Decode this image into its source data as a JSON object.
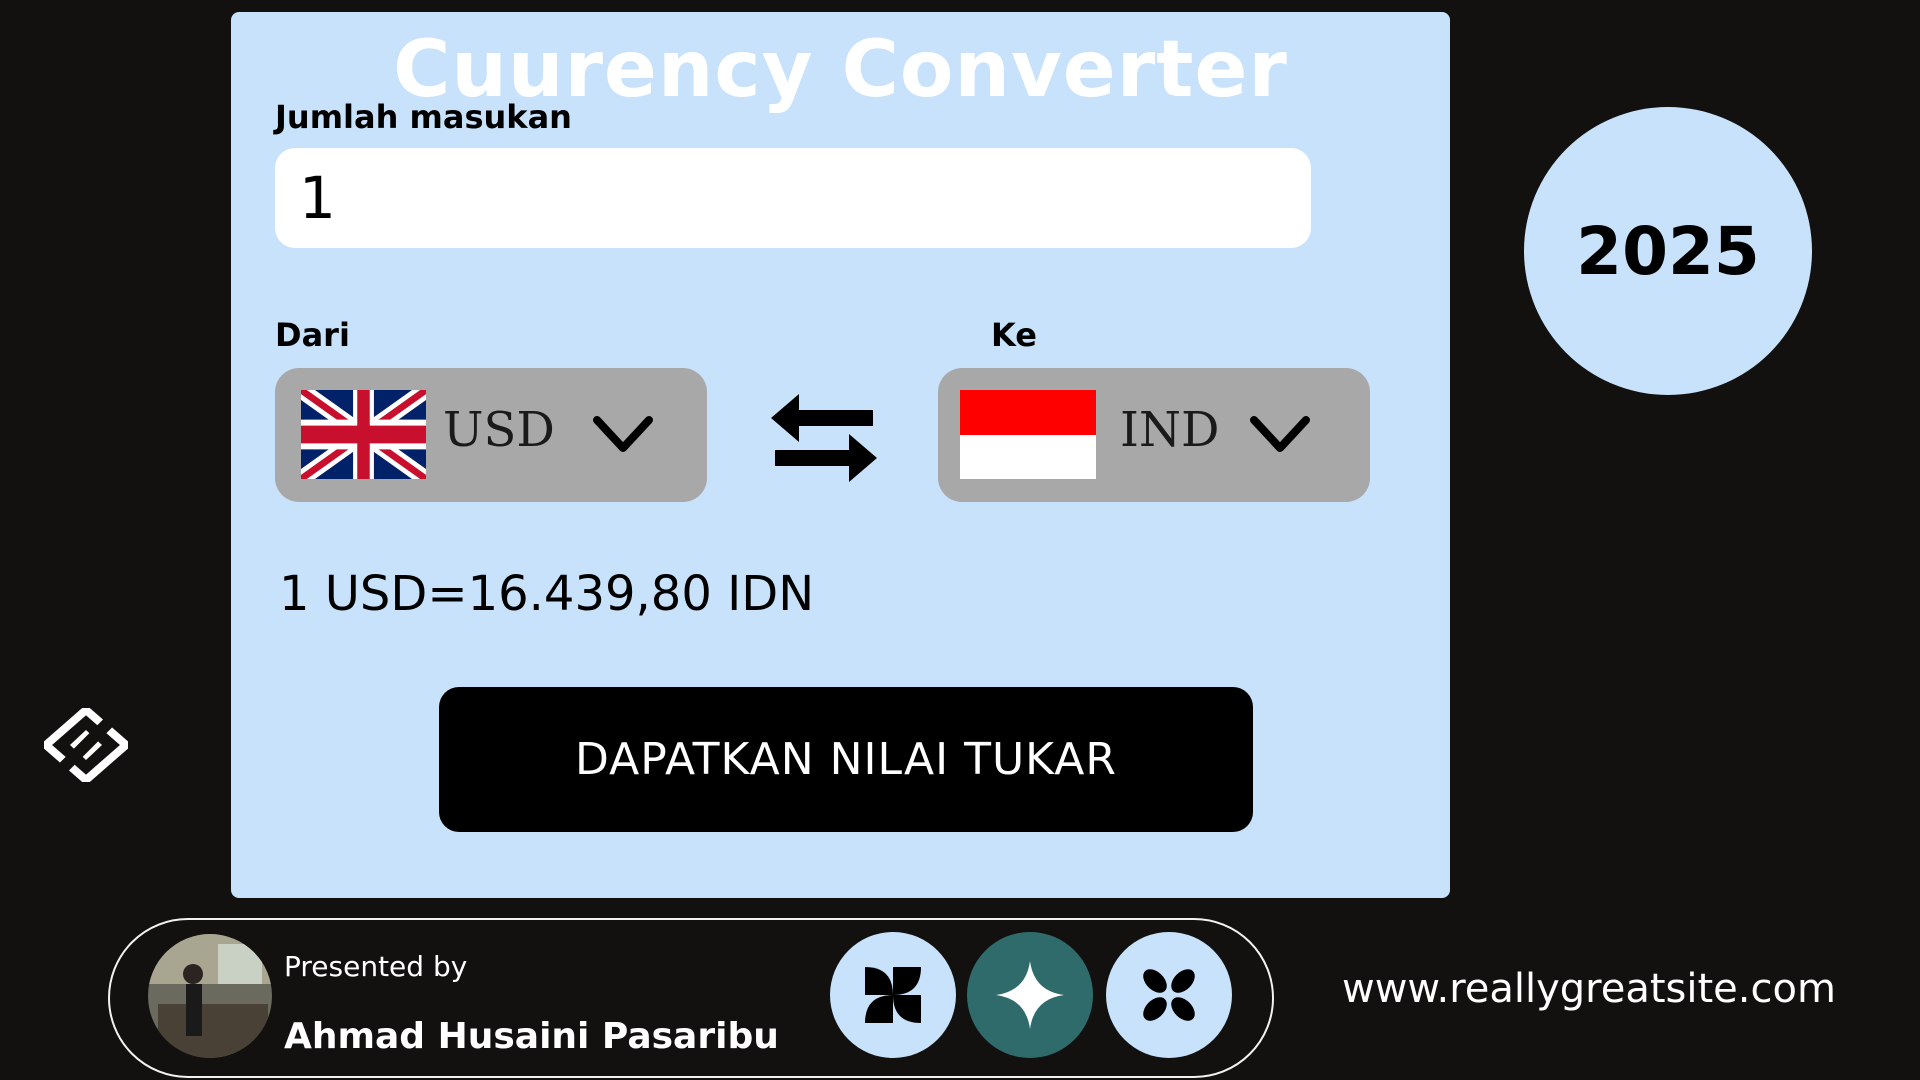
{
  "app": {
    "title": "Cuurency Converter",
    "year": "2025"
  },
  "form": {
    "amount_label": "Jumlah masukan",
    "amount_value": "1",
    "from_label": "Dari",
    "to_label": "Ke",
    "from_currency": "USD",
    "to_currency": "IND",
    "from_flag": "uk-flag",
    "to_flag": "indonesia-flag",
    "swap_icon": "swap-arrows-icon",
    "rate_text": "1 USD=16.439,80 IDN",
    "submit_label": "DAPATKAN NILAI TUKAR"
  },
  "footer": {
    "presented_by": "Presented by",
    "author": "Ahmad Husaini Pasaribu",
    "website": "www.reallygreatsite.com",
    "icons": [
      "pinwheel-icon",
      "sparkle-icon",
      "flower-icon"
    ]
  },
  "colors": {
    "card_bg": "#c7e2fa",
    "page_bg": "#121110",
    "select_bg": "#a8a8a8",
    "accent_teal": "#2f6b6b"
  }
}
